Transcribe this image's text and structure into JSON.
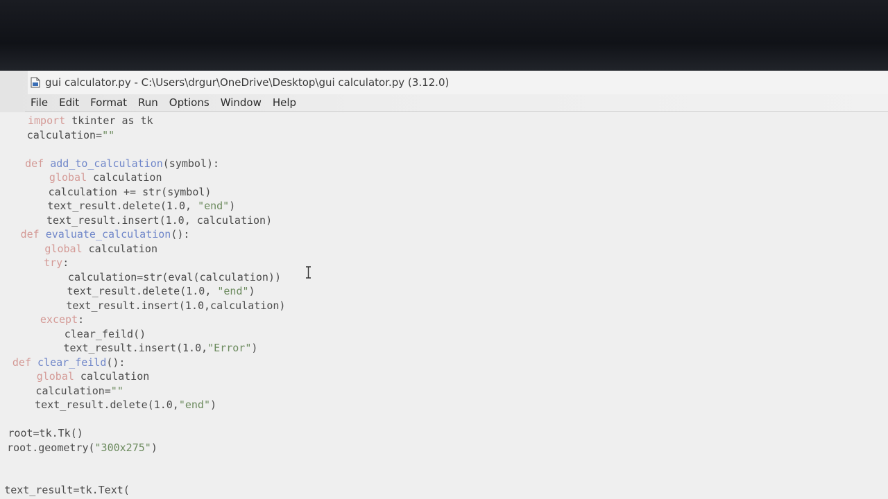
{
  "window": {
    "title": "gui calculator.py - C:\\Users\\drgur\\OneDrive\\Desktop\\gui calculator.py (3.12.0)"
  },
  "menu": {
    "items": [
      "File",
      "Edit",
      "Format",
      "Run",
      "Options",
      "Window",
      "Help"
    ]
  },
  "editor": {
    "lines": [
      {
        "segments": [
          {
            "t": "kw",
            "text": "import"
          },
          {
            "t": "n",
            "text": " tkinter as tk"
          }
        ]
      },
      {
        "segments": [
          {
            "t": "n",
            "text": "calculation="
          },
          {
            "t": "str",
            "text": "\"\""
          }
        ]
      },
      {
        "segments": []
      },
      {
        "segments": [
          {
            "t": "kw",
            "text": "def"
          },
          {
            "t": "n",
            "text": " "
          },
          {
            "t": "def",
            "text": "add_to_calculation"
          },
          {
            "t": "n",
            "text": "(symbol):"
          }
        ]
      },
      {
        "segments": [
          {
            "t": "n",
            "text": "    "
          },
          {
            "t": "kw",
            "text": "global"
          },
          {
            "t": "n",
            "text": " calculation"
          }
        ]
      },
      {
        "segments": [
          {
            "t": "n",
            "text": "    calculation += str(symbol)"
          }
        ]
      },
      {
        "segments": [
          {
            "t": "n",
            "text": "    text_result.delete(1.0, "
          },
          {
            "t": "str",
            "text": "\"end\""
          },
          {
            "t": "n",
            "text": ")"
          }
        ]
      },
      {
        "segments": [
          {
            "t": "n",
            "text": "    text_result.insert(1.0, calculation)"
          }
        ]
      },
      {
        "segments": [
          {
            "t": "kw",
            "text": "def"
          },
          {
            "t": "n",
            "text": " "
          },
          {
            "t": "def",
            "text": "evaluate_calculation"
          },
          {
            "t": "n",
            "text": "():"
          }
        ]
      },
      {
        "segments": [
          {
            "t": "n",
            "text": "    "
          },
          {
            "t": "kw",
            "text": "global"
          },
          {
            "t": "n",
            "text": " calculation"
          }
        ]
      },
      {
        "segments": [
          {
            "t": "n",
            "text": "    "
          },
          {
            "t": "kw",
            "text": "try"
          },
          {
            "t": "n",
            "text": ":"
          }
        ]
      },
      {
        "segments": [
          {
            "t": "n",
            "text": "        calculation=str(eval(calculation))"
          }
        ]
      },
      {
        "segments": [
          {
            "t": "n",
            "text": "        text_result.delete(1.0, "
          },
          {
            "t": "str",
            "text": "\"end\""
          },
          {
            "t": "n",
            "text": ")"
          }
        ]
      },
      {
        "segments": [
          {
            "t": "n",
            "text": "        text_result.insert(1.0,calculation)"
          }
        ]
      },
      {
        "segments": [
          {
            "t": "n",
            "text": "    "
          },
          {
            "t": "kw",
            "text": "except"
          },
          {
            "t": "n",
            "text": ":"
          }
        ]
      },
      {
        "segments": [
          {
            "t": "n",
            "text": "        clear_feild()"
          }
        ]
      },
      {
        "segments": [
          {
            "t": "n",
            "text": "        text_result.insert(1.0,"
          },
          {
            "t": "str",
            "text": "\"Error\""
          },
          {
            "t": "n",
            "text": ")"
          }
        ]
      },
      {
        "segments": [
          {
            "t": "kw",
            "text": "def"
          },
          {
            "t": "n",
            "text": " "
          },
          {
            "t": "def",
            "text": "clear_feild"
          },
          {
            "t": "n",
            "text": "():"
          }
        ]
      },
      {
        "segments": [
          {
            "t": "n",
            "text": "    "
          },
          {
            "t": "kw",
            "text": "global"
          },
          {
            "t": "n",
            "text": " calculation"
          }
        ]
      },
      {
        "segments": [
          {
            "t": "n",
            "text": "    calculation="
          },
          {
            "t": "str",
            "text": "\"\""
          }
        ]
      },
      {
        "segments": [
          {
            "t": "n",
            "text": "    text_result.delete(1.0,"
          },
          {
            "t": "str",
            "text": "\"end\""
          },
          {
            "t": "n",
            "text": ")"
          }
        ]
      },
      {
        "segments": []
      },
      {
        "segments": [
          {
            "t": "n",
            "text": "root=tk.Tk()"
          }
        ]
      },
      {
        "segments": [
          {
            "t": "n",
            "text": "root.geometry("
          },
          {
            "t": "str",
            "text": "\"300x275\""
          },
          {
            "t": "n",
            "text": ")"
          }
        ]
      },
      {
        "segments": []
      },
      {
        "segments": []
      },
      {
        "segments": [
          {
            "t": "n",
            "text": "text_result=tk.Text("
          }
        ]
      }
    ]
  },
  "colors": {
    "keyword": "#d49a96",
    "definition": "#6f86c9",
    "string": "#6b8a5d",
    "text": "#4a4a4a"
  }
}
